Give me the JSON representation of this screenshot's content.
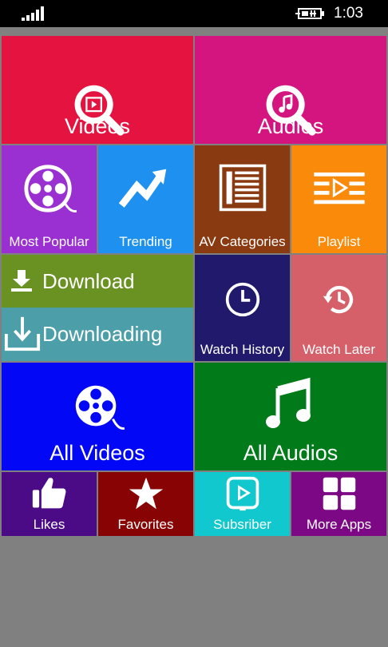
{
  "status_bar": {
    "time": "1:03"
  },
  "tiles": {
    "videos": {
      "label": "Videos",
      "color": "#e51340"
    },
    "audios": {
      "label": "Audios",
      "color": "#d4157f"
    },
    "most_popular": {
      "label": "Most Popular",
      "color": "#9a2fd2"
    },
    "trending": {
      "label": "Trending",
      "color": "#1d90f0"
    },
    "av_categories": {
      "label": "AV Categories",
      "color": "#8a3a10"
    },
    "playlist": {
      "label": "Playlist",
      "color": "#f98a0a"
    },
    "download": {
      "label": "Download",
      "color": "#6a9222"
    },
    "downloading": {
      "label": "Downloading",
      "color": "#4c9fa8"
    },
    "watch_history": {
      "label": "Watch History",
      "color": "#211a6c"
    },
    "watch_later": {
      "label": "Watch Later",
      "color": "#d5606a"
    },
    "all_videos": {
      "label": "All Videos",
      "color": "#0208f5"
    },
    "all_audios": {
      "label": "All Audios",
      "color": "#017a1a"
    },
    "likes": {
      "label": "Likes",
      "color": "#4b0a86"
    },
    "favorites": {
      "label": "Favorites",
      "color": "#880404"
    },
    "subscriber": {
      "label": "Subsriber",
      "color": "#12c8cf"
    },
    "more_apps": {
      "label": "More Apps",
      "color": "#7c0886"
    }
  },
  "icons": {
    "videos": "video-search-icon",
    "audios": "audio-search-icon",
    "most_popular": "film-reel-icon",
    "trending": "trending-arrow-icon",
    "av_categories": "list-icon",
    "playlist": "playlist-icon",
    "download": "download-icon",
    "downloading": "downloading-icon",
    "watch_history": "clock-icon",
    "watch_later": "history-clock-icon",
    "all_videos": "film-reel-icon",
    "all_audios": "music-note-icon",
    "likes": "thumbs-up-icon",
    "favorites": "star-icon",
    "subscriber": "subscribe-play-icon",
    "more_apps": "apps-grid-icon"
  }
}
